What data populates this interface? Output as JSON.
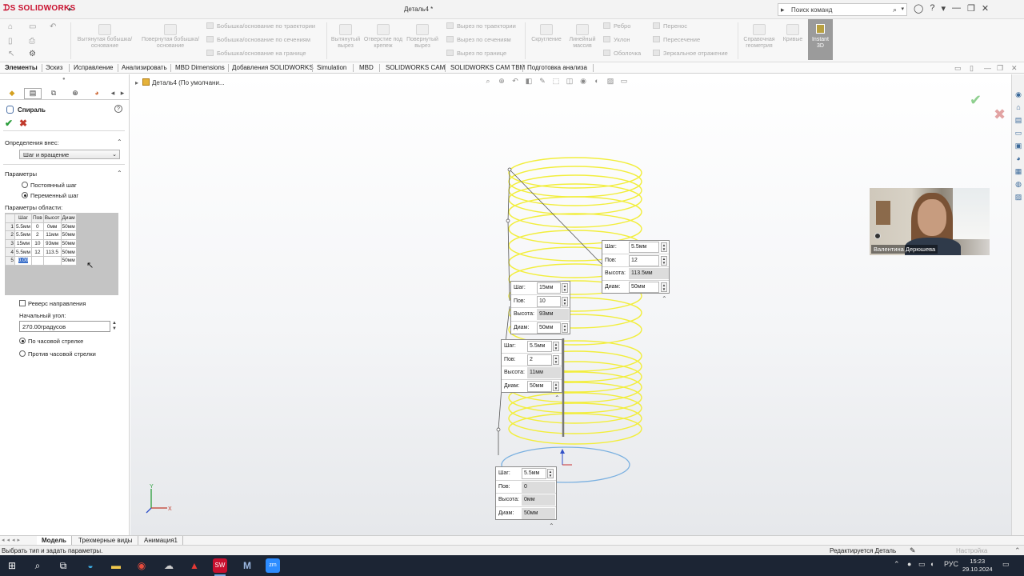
{
  "titlebar": {
    "app_name": "SOLIDWORKS",
    "document": "Деталь4 *",
    "search_placeholder": "Поиск команд"
  },
  "ribbon": {
    "big_buttons": [
      "Вытянутая бобышка/основание",
      "Повернутая бобышка/основание",
      "Вытянутый вырез",
      "Отверстие под крепеж",
      "Повернутый вырез",
      "Скругление",
      "Линейный массив",
      "Справочная геометрия",
      "Кривые",
      "Instant 3D"
    ],
    "small_buttons": [
      "Бобышка/основание по траектории",
      "Бобышка/основание по сечениям",
      "Бобышка/основание на границе",
      "Вырез по траектории",
      "Вырез по сечениям",
      "Вырез по границе",
      "Ребро",
      "Уклон",
      "Оболочка",
      "Перенос",
      "Пересечение",
      "Зеркальное отражение"
    ]
  },
  "tabs": [
    "Элементы",
    "Эскиз",
    "Исправление",
    "Анализировать",
    "MBD Dimensions",
    "Добавления SOLIDWORKS",
    "Simulation",
    "MBD",
    "SOLIDWORKS CAM",
    "SOLIDWORKS CAM TBM",
    "Подготовка анализа"
  ],
  "property_manager": {
    "title": "Спираль",
    "defined_by_label": "Определения внес:",
    "defined_by_value": "Шаг и вращение",
    "params_label": "Параметры",
    "constant_pitch": "Постоянный шаг",
    "variable_pitch": "Переменный шаг",
    "region_label": "Параметры области:",
    "table_headers": [
      "Шаг",
      "Пов",
      "Высот",
      "Диам"
    ],
    "table_rows": [
      [
        "1",
        "5.5мм",
        "0",
        "0мм",
        "50мм"
      ],
      [
        "2",
        "5.5мм",
        "2",
        "11мм",
        "50мм"
      ],
      [
        "3",
        "15мм",
        "10",
        "93мм",
        "50мм"
      ],
      [
        "4",
        "5.5мм",
        "12",
        "113.5",
        "50мм"
      ],
      [
        "5",
        "0.00",
        "",
        "",
        "50мм"
      ]
    ],
    "reverse_direction": "Реверс направления",
    "start_angle_label": "Начальный угол:",
    "start_angle_value": "270.00градусов",
    "clockwise": "По часовой стрелке",
    "counterclockwise": "Против часовой стрелки"
  },
  "graphics": {
    "tree_item": "Деталь4  (По умолчани..."
  },
  "callouts": [
    {
      "pitch": "5.5мм",
      "turns": "12",
      "height": "113.5мм",
      "diam": "50мм"
    },
    {
      "pitch": "15мм",
      "turns": "10",
      "height": "93мм",
      "diam": "50мм"
    },
    {
      "pitch": "5.5мм",
      "turns": "2",
      "height": "11мм",
      "diam": "50мм"
    },
    {
      "pitch": "5.5мм",
      "turns": "0",
      "height": "0мм",
      "diam": "50мм"
    }
  ],
  "callout_labels": {
    "pitch": "Шаг:",
    "turns": "Пов:",
    "height": "Высота:",
    "diam": "Диам:"
  },
  "webcam": {
    "name": "Валентина Дерюшева"
  },
  "bottom_tabs": [
    "Модель",
    "Трехмерные виды",
    "Анимация1"
  ],
  "status": {
    "message": "Выбрать тип и задать параметры.",
    "editing": "Редактируется Деталь",
    "settings": "Настройка"
  },
  "taskbar": {
    "lang": "РУС",
    "time": "15:23",
    "date": "29.10.2024"
  },
  "colors": {
    "helix": "#f2ee3c",
    "sw_red": "#c8102e",
    "circle": "#7ab0e0"
  }
}
